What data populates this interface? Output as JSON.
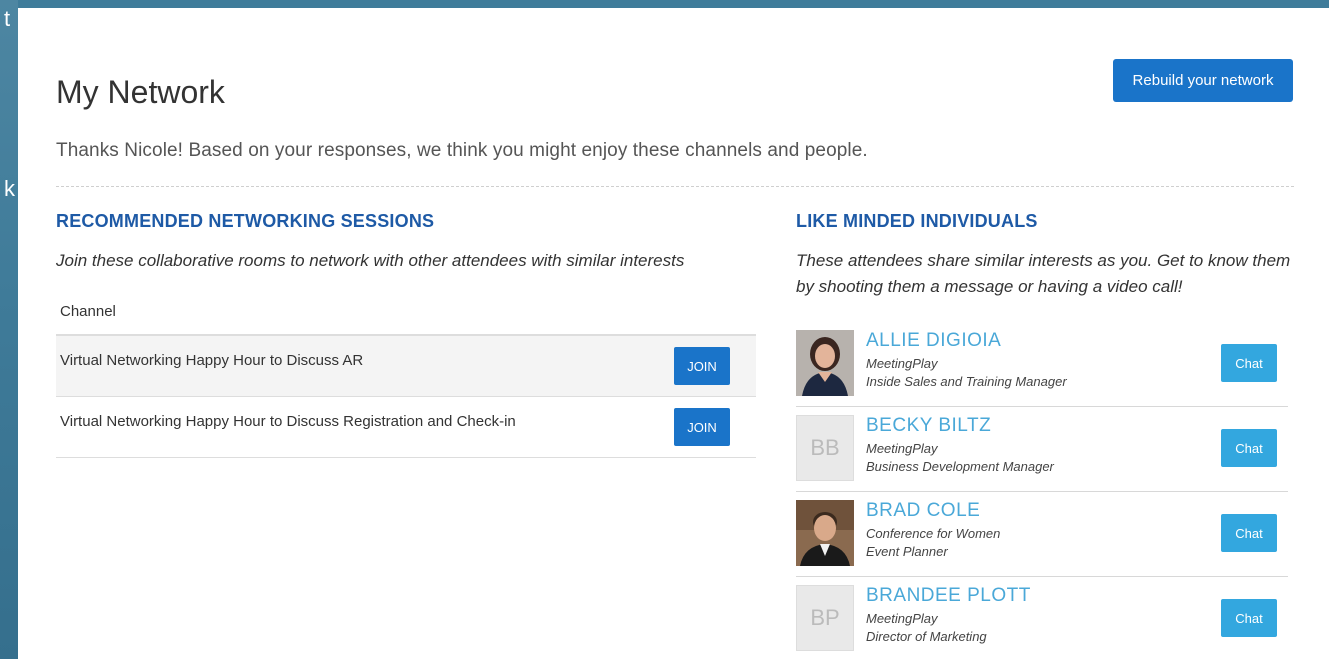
{
  "background_fragments": [
    "t",
    "k"
  ],
  "header": {
    "title": "My Network",
    "rebuild_label": "Rebuild your network",
    "intro": "Thanks Nicole! Based on your responses, we think you might enjoy these channels and people."
  },
  "sessions": {
    "heading": "RECOMMENDED NETWORKING SESSIONS",
    "description": "Join these collaborative rooms to network with other attendees with similar interests",
    "column_header": "Channel",
    "rows": [
      {
        "name": "Virtual Networking Happy Hour to Discuss AR",
        "action": "JOIN"
      },
      {
        "name": "Virtual Networking Happy Hour to Discuss Registration and Check-in",
        "action": "JOIN"
      }
    ]
  },
  "individuals": {
    "heading": "LIKE MINDED INDIVIDUALS",
    "description": "These attendees share similar interests as you. Get to know them by shooting them a message or having a video call!",
    "people": [
      {
        "name": "ALLIE DIGIOIA",
        "company": "MeetingPlay",
        "title": "Inside Sales and Training Manager",
        "avatar": "photo",
        "initials": "",
        "action": "Chat"
      },
      {
        "name": "BECKY BILTZ",
        "company": "MeetingPlay",
        "title": "Business Development Manager",
        "avatar": "initials",
        "initials": "BB",
        "action": "Chat"
      },
      {
        "name": "BRAD COLE",
        "company": "Conference for Women",
        "title": "Event Planner",
        "avatar": "photo",
        "initials": "",
        "action": "Chat"
      },
      {
        "name": "BRANDEE PLOTT",
        "company": "MeetingPlay",
        "title": "Director of Marketing",
        "avatar": "initials",
        "initials": "BP",
        "action": "Chat"
      }
    ]
  },
  "colors": {
    "primary_button": "#1a74c9",
    "chat_button": "#33a7df",
    "heading": "#1e5aa6",
    "person_name": "#4aa8d8",
    "backdrop": "#3f7c9a"
  }
}
